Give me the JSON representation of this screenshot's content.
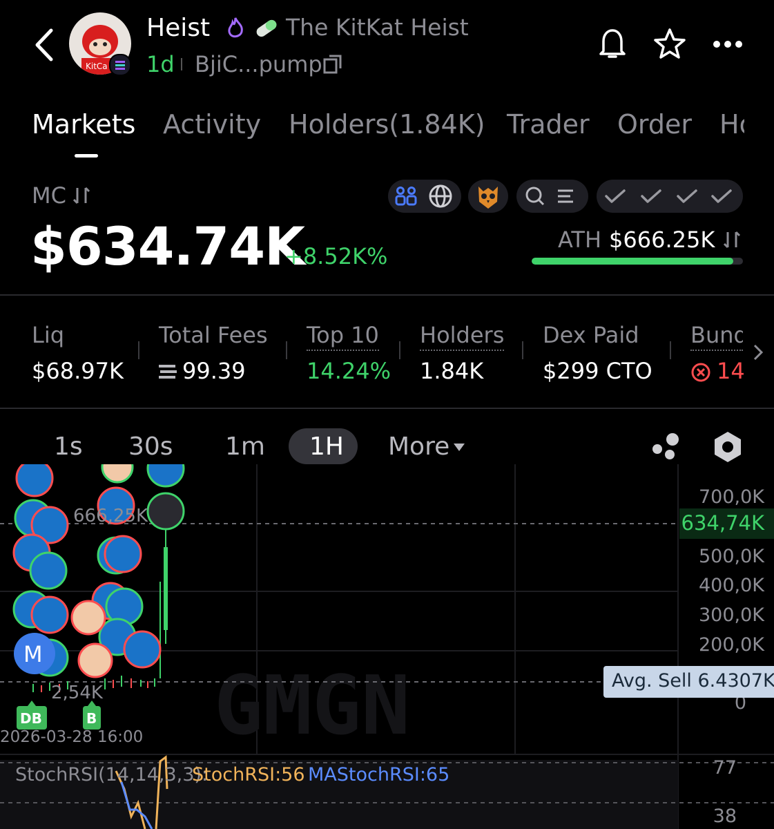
{
  "header": {
    "token_name": "Heist",
    "token_fullname": "The KitKat Heist",
    "age": "1d",
    "address": "BjiC...pump"
  },
  "tabs": [
    {
      "label": "Markets"
    },
    {
      "label": "Activity"
    },
    {
      "label": "Holders(1.84K)"
    },
    {
      "label": "Trader"
    },
    {
      "label": "Order"
    },
    {
      "label": "Ho"
    }
  ],
  "market": {
    "mc_label": "MC",
    "mc_value": "$634.74K",
    "mc_change": "+8.52K%",
    "ath_label": "ATH",
    "ath_value": "$666.25K",
    "ath_progress": 0.953
  },
  "stats": [
    {
      "label": "Liq",
      "value": "$68.97K"
    },
    {
      "label": "Total Fees",
      "value": "99.39"
    },
    {
      "label": "Top 10",
      "value": "14.24%"
    },
    {
      "label": "Holders",
      "value": "1.84K"
    },
    {
      "label": "Dex Paid",
      "value": "$299 CTO"
    },
    {
      "label": "Bund",
      "value": "14."
    }
  ],
  "timeframes": [
    {
      "label": "1s"
    },
    {
      "label": "30s"
    },
    {
      "label": "1m"
    },
    {
      "label": "1H"
    },
    {
      "label": "More"
    }
  ],
  "chart": {
    "y_axis_labels": [
      "700,0K",
      "500,0K",
      "400,0K",
      "300,0K",
      "200,0K",
      "0"
    ],
    "current_price_label": "634,74K",
    "ath_line_label": "666,25K",
    "low_line_label": "2,54K",
    "avg_sell_label": "Avg. Sell 6.4307K",
    "date_label": "2026-03-28 16:00",
    "marker_db": "DB",
    "marker_b": "B",
    "marker_m": "M",
    "watermark": "GMGN"
  },
  "indicator": {
    "name": "StochRSI(14,14,3,3):",
    "stoch_label": "StochRSI:56",
    "ma_label": "MAStochRSI:65",
    "y_labels": [
      "77",
      "38"
    ]
  },
  "colors": {
    "green": "#3fd36a",
    "red": "#ff4d4f",
    "stoch": "#f0b35a",
    "ma_stoch": "#5b8cff",
    "blue_icon": "#4b7bff"
  }
}
